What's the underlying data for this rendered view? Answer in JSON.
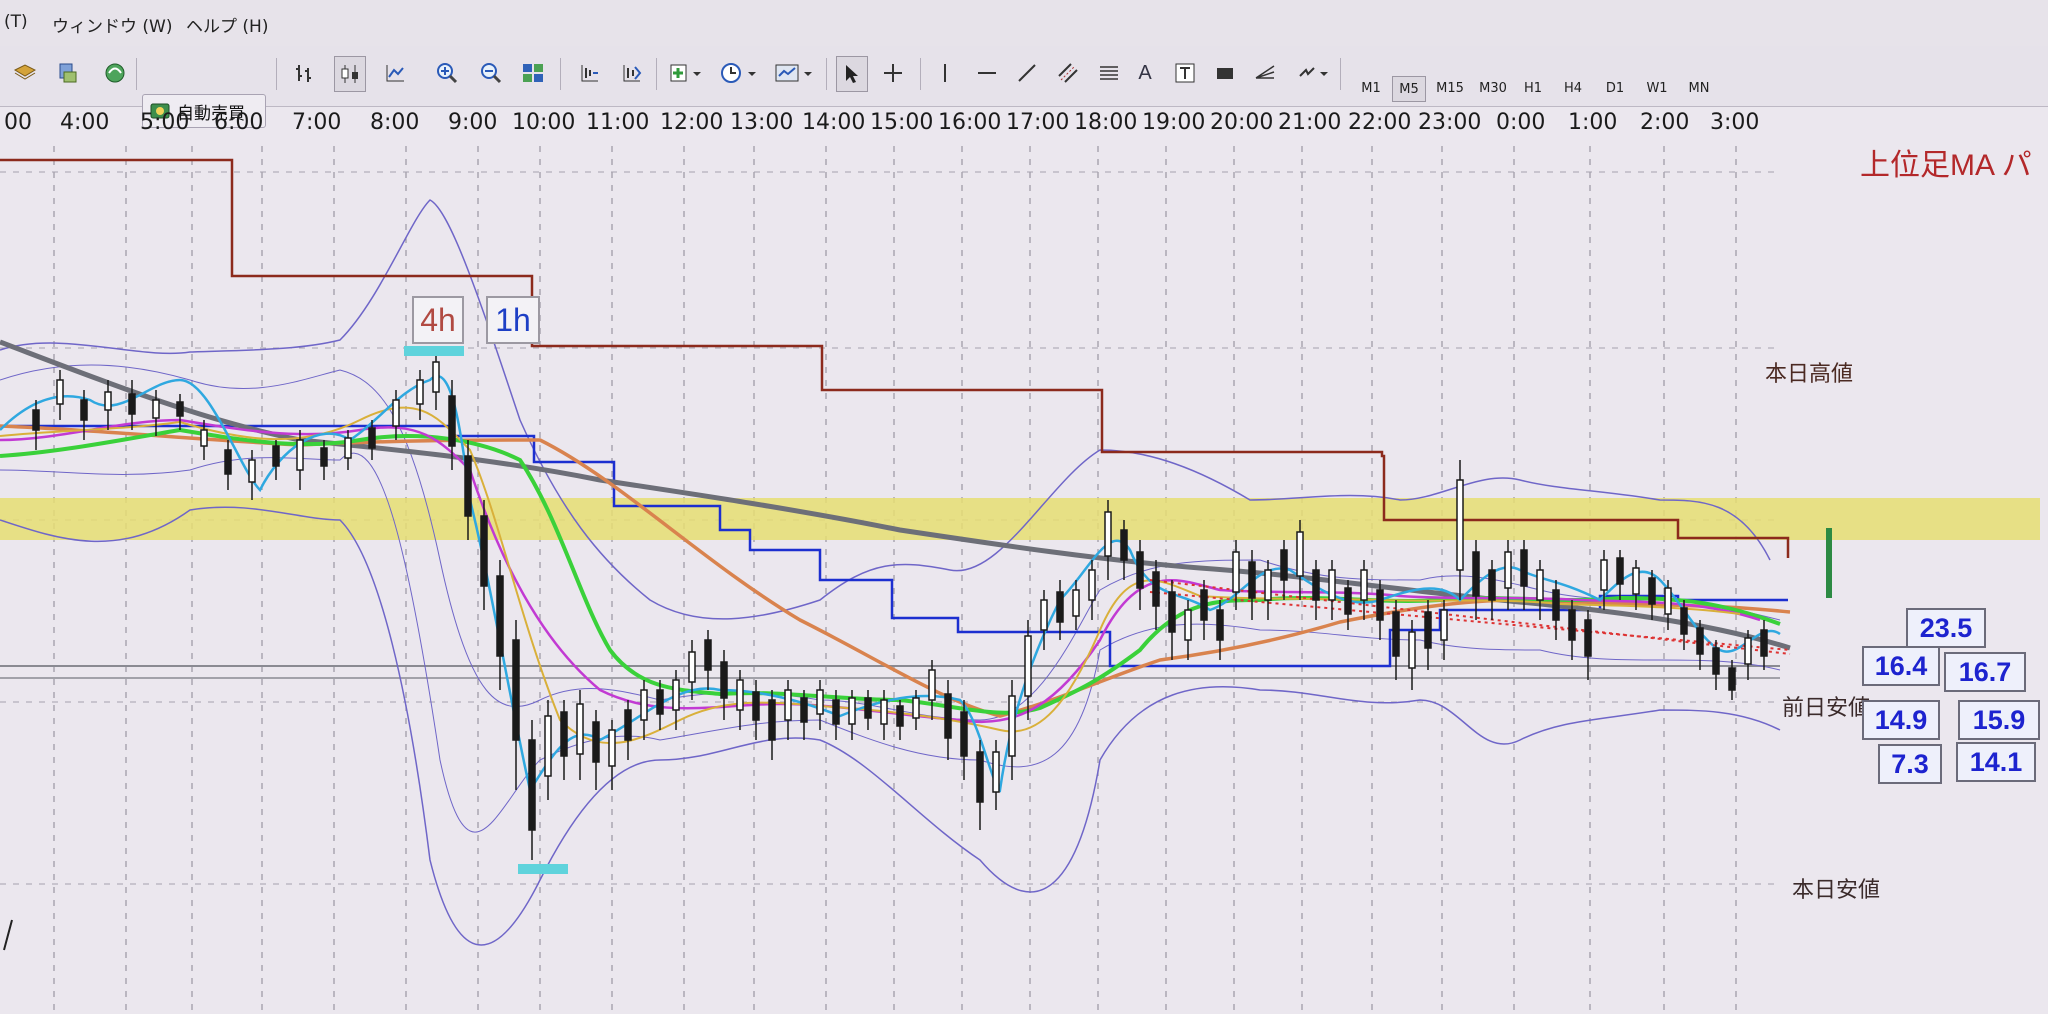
{
  "menu": {
    "items": [
      "(T)",
      "ウィンドウ (W)",
      "ヘルプ (H)"
    ]
  },
  "toolbar": {
    "auto_trade_label": "自動売買",
    "timeframes": [
      "M1",
      "M5",
      "M15",
      "M30",
      "H1",
      "H4",
      "D1",
      "W1",
      "MN"
    ],
    "active_timeframe": "M5",
    "text_tool_label": "A"
  },
  "timescale": {
    "labels": [
      "00",
      "4:00",
      "5:00",
      "6:00",
      "7:00",
      "8:00",
      "9:00",
      "10:00",
      "11:00",
      "12:00",
      "13:00",
      "14:00",
      "15:00",
      "16:00",
      "17:00",
      "18:00",
      "19:00",
      "20:00",
      "21:00",
      "22:00",
      "23:00",
      "0:00",
      "1:00",
      "2:00",
      "3:00"
    ]
  },
  "chart": {
    "ma_title": "上位足MA パ",
    "today_high_label": "本日高値",
    "prev_low_label": "前日安値",
    "today_low_label": "本日安値",
    "tag_4h": "4h",
    "tag_1h": "1h",
    "values_left": [
      "23.5",
      "16.4",
      "14.9",
      "7.3"
    ],
    "values_right": [
      "16.7",
      "15.9",
      "14.1"
    ],
    "colors": {
      "band": "#e6de72",
      "upper_ma": "#8c2a1c",
      "blue_ma": "#1c2fd0",
      "gray_ma": "#6d6f78",
      "green_ma": "#3ad13a",
      "orange_ma": "#d9834e",
      "magenta_ma": "#c23ad3",
      "cyan_ma": "#2fa8e0",
      "yellow_ma": "#d9b03a",
      "bollinger": "#6f66c8",
      "value_text": "#1d23cf"
    }
  }
}
